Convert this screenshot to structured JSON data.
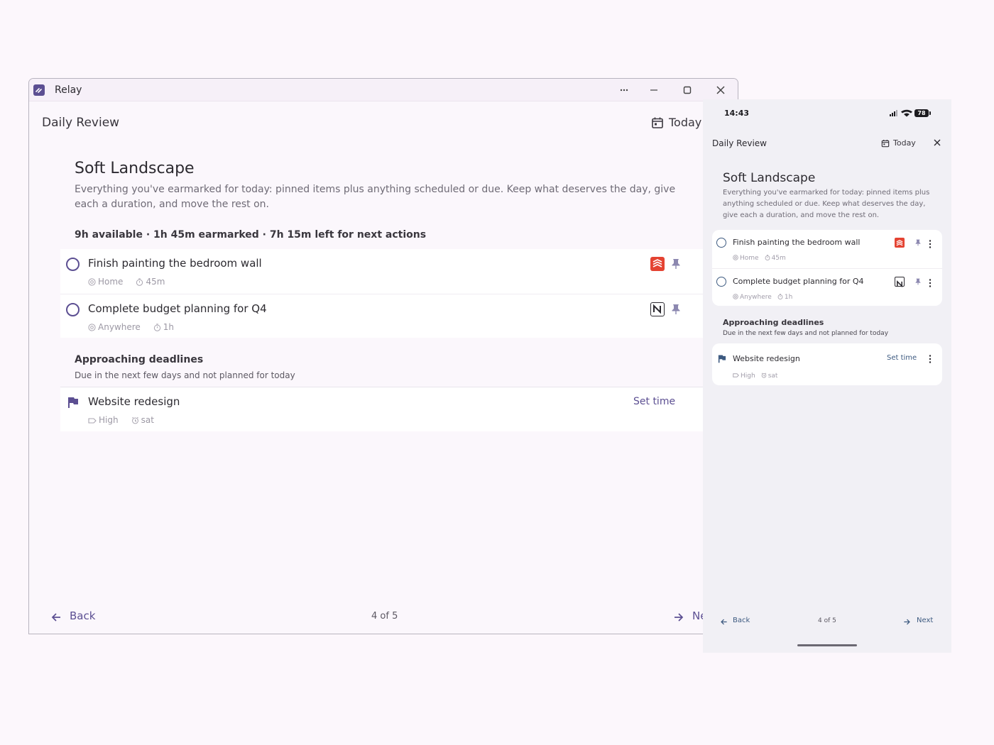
{
  "colors": {
    "accent": "#5c4f92",
    "mobile_accent": "#3d5a80",
    "todoist_red": "#e44332",
    "background": "#fcf7fc"
  },
  "desktop": {
    "app_title": "Relay",
    "header": "Daily Review",
    "today_label": "Today",
    "title": "Soft Landscape",
    "description": "Everything you've earmarked for today: pinned items plus anything scheduled or due. Keep what deserves the day, give each a duration, and move the rest on.",
    "summary": "9h available · 1h 45m earmarked · 7h 15m left for next actions",
    "tasks": [
      {
        "name": "Finish painting the bedroom wall",
        "context": "Home",
        "duration": "45m",
        "source_icon": "todoist-icon"
      },
      {
        "name": "Complete budget planning for Q4",
        "context": "Anywhere",
        "duration": "1h",
        "source_icon": "notion-icon"
      }
    ],
    "deadlines_title": "Approaching deadlines",
    "deadlines_subtitle": "Due in the next few days and not planned for today",
    "deadline_task": {
      "name": "Website redesign",
      "priority": "High",
      "due": "sat",
      "action": "Set time"
    },
    "back_label": "Back",
    "page_indicator": "4 of 5",
    "next_label": "Ne"
  },
  "mobile": {
    "time": "14:43",
    "battery": "78",
    "header": "Daily Review",
    "today_label": "Today",
    "title": "Soft Landscape",
    "description": "Everything you've earmarked for today: pinned items plus anything scheduled or due. Keep what deserves the day, give each a duration, and move the rest on.",
    "tasks": [
      {
        "name": "Finish painting the bedroom wall",
        "context": "Home",
        "duration": "45m",
        "source_icon": "todoist-icon"
      },
      {
        "name": "Complete budget planning for Q4",
        "context": "Anywhere",
        "duration": "1h",
        "source_icon": "notion-icon"
      }
    ],
    "deadlines_title": "Approaching deadlines",
    "deadlines_subtitle": "Due in the next few days and not planned for today",
    "deadline_task": {
      "name": "Website redesign",
      "priority": "High",
      "due": "sat",
      "action": "Set time"
    },
    "back_label": "Back",
    "page_indicator": "4 of 5",
    "next_label": "Next"
  }
}
